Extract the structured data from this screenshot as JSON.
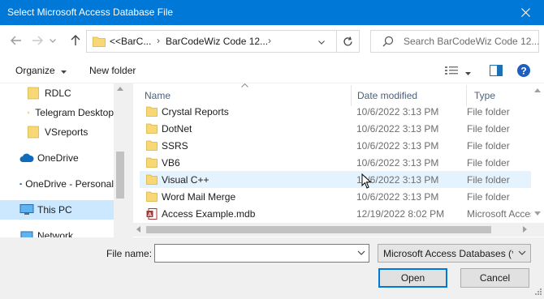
{
  "window": {
    "title": "Select Microsoft Access Database File"
  },
  "address": {
    "overflow": "<<",
    "segments": [
      "BarC...",
      "BarCodeWiz Code 12..."
    ]
  },
  "search": {
    "placeholder": "Search BarCodeWiz Code 12..."
  },
  "toolbar": {
    "organize": "Organize",
    "new_folder": "New folder"
  },
  "sidebar": {
    "items": [
      {
        "label": "RDLC",
        "icon": "folder-icon"
      },
      {
        "label": "Telegram Desktop",
        "icon": "folder-icon"
      },
      {
        "label": "VSreports",
        "icon": "folder-icon"
      },
      {
        "label": "OneDrive",
        "icon": "cloud-icon"
      },
      {
        "label": "OneDrive - Personal",
        "icon": "cloud-icon"
      },
      {
        "label": "This PC",
        "icon": "computer-icon"
      },
      {
        "label": "Network",
        "icon": "network-icon"
      }
    ]
  },
  "columns": {
    "name": "Name",
    "date": "Date modified",
    "type": "Type"
  },
  "files": [
    {
      "name": "Crystal Reports",
      "date": "10/6/2022 3:13 PM",
      "type": "File folder",
      "icon": "folder-icon"
    },
    {
      "name": "DotNet",
      "date": "10/6/2022 3:13 PM",
      "type": "File folder",
      "icon": "folder-icon"
    },
    {
      "name": "SSRS",
      "date": "10/6/2022 3:13 PM",
      "type": "File folder",
      "icon": "folder-icon"
    },
    {
      "name": "VB6",
      "date": "10/6/2022 3:13 PM",
      "type": "File folder",
      "icon": "folder-icon"
    },
    {
      "name": "Visual C++",
      "date": "10/6/2022 3:13 PM",
      "type": "File folder",
      "icon": "folder-icon"
    },
    {
      "name": "Word Mail Merge",
      "date": "10/6/2022 3:13 PM",
      "type": "File folder",
      "icon": "folder-icon"
    },
    {
      "name": "Access Example.mdb",
      "date": "12/19/2022 8:02 PM",
      "type": "Microsoft Access",
      "icon": "access-file-icon"
    }
  ],
  "filename": {
    "label": "File name:",
    "value": ""
  },
  "filetype": {
    "selected": "Microsoft Access Databases (*.mdb)"
  },
  "buttons": {
    "open": "Open",
    "cancel": "Cancel"
  },
  "colors": {
    "titlebar": "#0078d7",
    "selection": "#cce8ff",
    "hover": "#e5f3ff",
    "folder": "#f8d775"
  }
}
